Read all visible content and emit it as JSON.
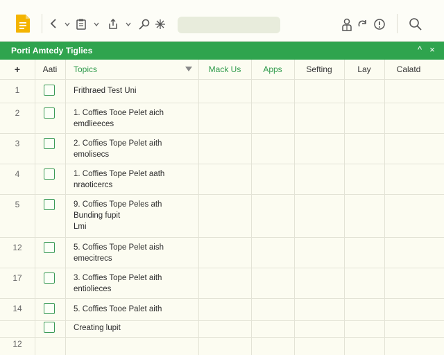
{
  "toolbar": {
    "icons": [
      "document-icon",
      "back-icon",
      "chevron-down-icon",
      "clipboard-icon",
      "chevron-down-icon",
      "share-icon",
      "chevron-down-icon",
      "search-tool-icon",
      "magic-icon",
      "person-icon",
      "redo-icon",
      "info-icon",
      "search-icon"
    ],
    "search_value": ""
  },
  "titlebar": {
    "title": "Porti Amtedy Tiglies",
    "up_glyph": "^",
    "close_glyph": "×"
  },
  "columns": {
    "add": "+",
    "aati": "Aati",
    "topics": "Topics",
    "mack_us": "Mack Us",
    "apps": "Apps",
    "sefting": "Sefting",
    "lay": "Lay",
    "calatd": "Calatd"
  },
  "rows": [
    {
      "num": "1",
      "topic": "Frithraed Test Uni"
    },
    {
      "num": "2",
      "topic": "1. Coffies Tooe Pelet aich\nemdlieeces"
    },
    {
      "num": "3",
      "topic": "2. Coffies Tope Pelet aith\nemolisecs"
    },
    {
      "num": "4",
      "topic": "1. Coffies Tope Pelet aath\nnraoticercs"
    },
    {
      "num": "5",
      "topic": "9. Coffies Tope Peles ath\nBunding fupit\nLmi"
    },
    {
      "num": "12",
      "topic": "5. Coffies Tope Pelet aish\nemecitrecs"
    },
    {
      "num": "17",
      "topic": "3. Coffies Tope Pelet aith\nentiolieces"
    },
    {
      "num": "14",
      "topic": "5. Coffies Tooe Palet aith"
    },
    {
      "num": "",
      "topic": "Creating lupit"
    },
    {
      "num": "12",
      "topic": ""
    }
  ],
  "colors": {
    "accent_green": "#2fa44e",
    "checkbox_green": "#3a9a55",
    "doc_icon_yellow": "#f4b400"
  }
}
